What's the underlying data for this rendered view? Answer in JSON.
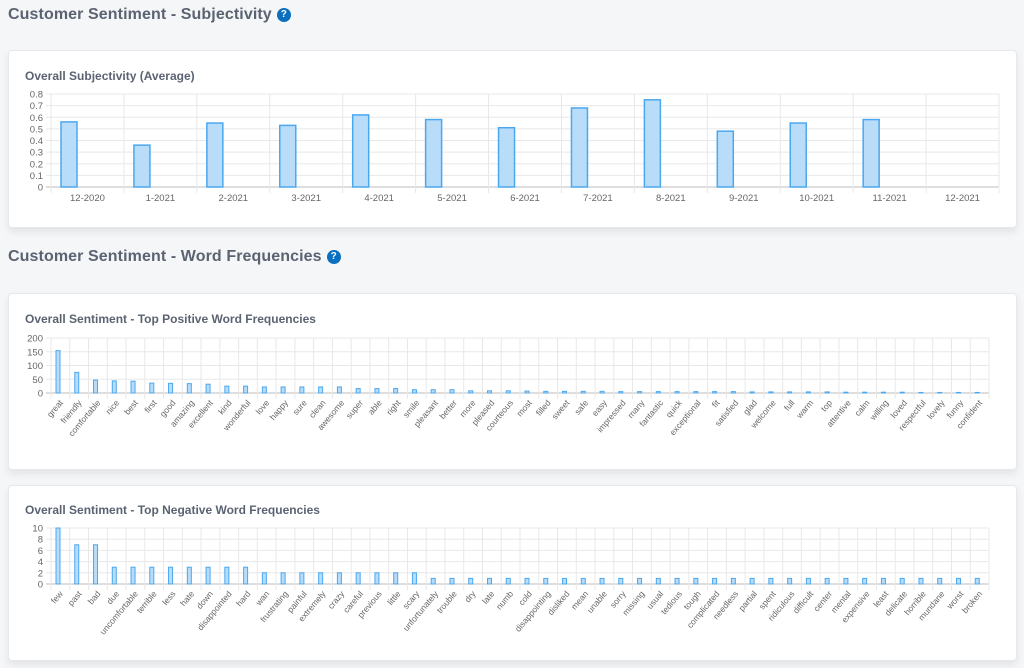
{
  "sections": {
    "subjectivity_title": "Customer Sentiment - Subjectivity",
    "word_freq_title": "Customer Sentiment - Word Frequencies",
    "help_icon": "?"
  },
  "colors": {
    "bar_fill": "#b9dcf9",
    "bar_border": "#4aa8ef",
    "help_icon": "#0b6fbf"
  },
  "chart_data": [
    {
      "type": "bar",
      "title": "Overall Subjectivity (Average)",
      "xlabel": "",
      "ylabel": "",
      "ylim": [
        0,
        0.8
      ],
      "yticks": [
        "0",
        "0.1",
        "0.2",
        "0.3",
        "0.4",
        "0.5",
        "0.6",
        "0.7",
        "0.8"
      ],
      "grid": true,
      "categories": [
        "12-2020",
        "1-2021",
        "2-2021",
        "3-2021",
        "4-2021",
        "5-2021",
        "6-2021",
        "7-2021",
        "8-2021",
        "9-2021",
        "10-2021",
        "11-2021",
        "12-2021"
      ],
      "values": [
        0.56,
        0.36,
        0.55,
        0.53,
        0.62,
        0.58,
        0.51,
        0.68,
        0.75,
        0.48,
        0.55,
        0.58,
        null
      ]
    },
    {
      "type": "bar",
      "title": "Overall Sentiment - Top Positive Word Frequencies",
      "xlabel": "",
      "ylabel": "",
      "ylim": [
        0,
        200
      ],
      "yticks": [
        "0",
        "50",
        "100",
        "150",
        "200"
      ],
      "grid": true,
      "categories": [
        "great",
        "friendly",
        "comfortable",
        "nice",
        "best",
        "first",
        "good",
        "amazing",
        "excellent",
        "kind",
        "wonderful",
        "love",
        "happy",
        "sure",
        "clean",
        "awesome",
        "super",
        "able",
        "right",
        "smile",
        "pleasant",
        "better",
        "more",
        "pleased",
        "courteous",
        "most",
        "filled",
        "sweet",
        "safe",
        "easy",
        "impressed",
        "many",
        "fantastic",
        "quick",
        "exceptional",
        "fit",
        "satisfied",
        "glad",
        "welcome",
        "full",
        "warm",
        "top",
        "attentive",
        "calm",
        "willing",
        "loved",
        "respectful",
        "lovely",
        "funny",
        "confident"
      ],
      "values": [
        154,
        75,
        47,
        44,
        43,
        36,
        35,
        34,
        32,
        25,
        25,
        22,
        22,
        22,
        22,
        22,
        16,
        16,
        16,
        12,
        12,
        12,
        8,
        8,
        8,
        7,
        6,
        6,
        6,
        6,
        5,
        5,
        5,
        5,
        5,
        5,
        5,
        4,
        4,
        4,
        4,
        4,
        3,
        3,
        3,
        3,
        2,
        2,
        2,
        2
      ]
    },
    {
      "type": "bar",
      "title": "Overall Sentiment - Top Negative Word Frequencies",
      "xlabel": "",
      "ylabel": "",
      "ylim": [
        0,
        10
      ],
      "yticks": [
        "0",
        "2",
        "4",
        "6",
        "8",
        "10"
      ],
      "grid": true,
      "categories": [
        "few",
        "past",
        "bad",
        "due",
        "uncomfortable",
        "terrible",
        "less",
        "hate",
        "down",
        "disappointed",
        "hard",
        "wan",
        "frustrating",
        "painful",
        "extremely",
        "crazy",
        "careful",
        "previous",
        "little",
        "scary",
        "unfortunately",
        "trouble",
        "dry",
        "late",
        "numb",
        "cold",
        "disappointing",
        "disliked",
        "mean",
        "unable",
        "sorry",
        "missing",
        "usual",
        "tedious",
        "tough",
        "complicated",
        "needless",
        "partial",
        "spent",
        "ridiculous",
        "difficult",
        "center",
        "mental",
        "expensive",
        "least",
        "delicate",
        "horrible",
        "mundane",
        "worst",
        "broken"
      ],
      "values": [
        10,
        7,
        7,
        3,
        3,
        3,
        3,
        3,
        3,
        3,
        3,
        2,
        2,
        2,
        2,
        2,
        2,
        2,
        2,
        2,
        1,
        1,
        1,
        1,
        1,
        1,
        1,
        1,
        1,
        1,
        1,
        1,
        1,
        1,
        1,
        1,
        1,
        1,
        1,
        1,
        1,
        1,
        1,
        1,
        1,
        1,
        1,
        1,
        1,
        1
      ]
    }
  ]
}
